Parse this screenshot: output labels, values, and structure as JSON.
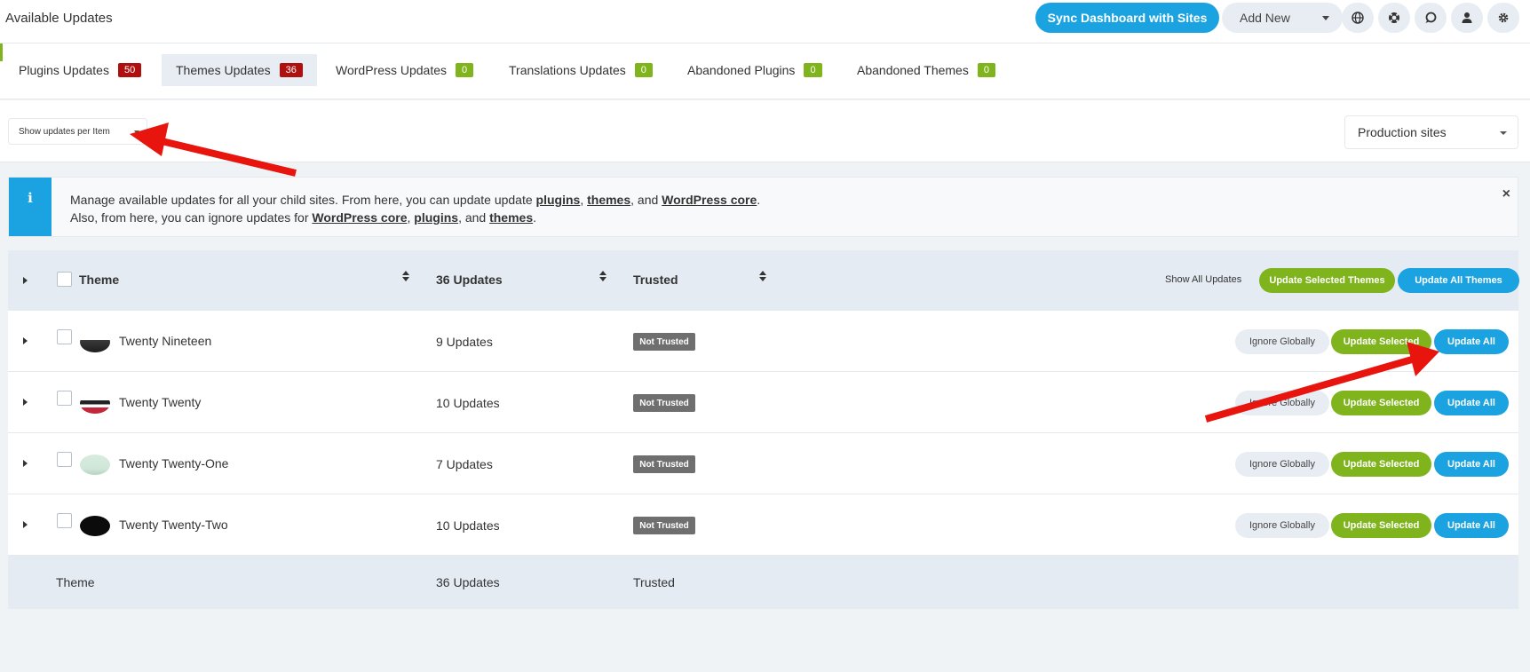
{
  "header": {
    "title": "Available Updates",
    "sync_label": "Sync Dashboard with Sites",
    "add_new_label": "Add New",
    "icons": [
      "globe-icon",
      "help-ring-icon",
      "chat-icon",
      "user-icon",
      "settings-icon"
    ]
  },
  "tabs": [
    {
      "label": "Plugins Updates",
      "count": "50",
      "badge_color": "#b00f0f",
      "active": false
    },
    {
      "label": "Themes Updates",
      "count": "36",
      "badge_color": "#b00f0f",
      "active": true
    },
    {
      "label": "WordPress Updates",
      "count": "0",
      "badge_color": "#7fb41d",
      "active": false
    },
    {
      "label": "Translations Updates",
      "count": "0",
      "badge_color": "#7fb41d",
      "active": false
    },
    {
      "label": "Abandoned Plugins",
      "count": "0",
      "badge_color": "#7fb41d",
      "active": false
    },
    {
      "label": "Abandoned Themes",
      "count": "0",
      "badge_color": "#7fb41d",
      "active": false
    }
  ],
  "filters": {
    "view_select": "Show updates per Item",
    "sites_select": "Production sites"
  },
  "notice": {
    "line1_pre": "Manage available updates for all your child sites. From here, you can update update ",
    "link_plugins": "plugins",
    "sep1": ", ",
    "link_themes": "themes",
    "sep2": ", and ",
    "link_core": "WordPress core",
    "line1_end": ".",
    "line2_pre": "Also, from here, you can ignore updates for ",
    "link2_core": "WordPress core",
    "link2_plugins": "plugins",
    "link2_themes": "themes",
    "line2_end": ".",
    "close": "×"
  },
  "table": {
    "headers": {
      "theme": "Theme",
      "updates": "36 Updates",
      "trusted": "Trusted",
      "show_all": "Show All Updates",
      "update_selected": "Update Selected Themes",
      "update_all": "Update All Themes"
    },
    "rows": [
      {
        "name": "Twenty Nineteen",
        "updates": "9 Updates",
        "status": "Not Trusted"
      },
      {
        "name": "Twenty Twenty",
        "updates": "10 Updates",
        "status": "Not Trusted"
      },
      {
        "name": "Twenty Twenty-One",
        "updates": "7 Updates",
        "status": "Not Trusted"
      },
      {
        "name": "Twenty Twenty-Two",
        "updates": "10 Updates",
        "status": "Not Trusted"
      }
    ],
    "row_actions": {
      "ignore": "Ignore Globally",
      "update_selected": "Update Selected",
      "update_all": "Update All"
    },
    "footer": {
      "theme": "Theme",
      "updates": "36 Updates",
      "trusted": "Trusted"
    }
  },
  "colors": {
    "accent_blue": "#1aa3e0",
    "accent_green": "#7fb41d",
    "badge_red": "#b00f0f",
    "annotation_arrow": "#e8140e"
  }
}
